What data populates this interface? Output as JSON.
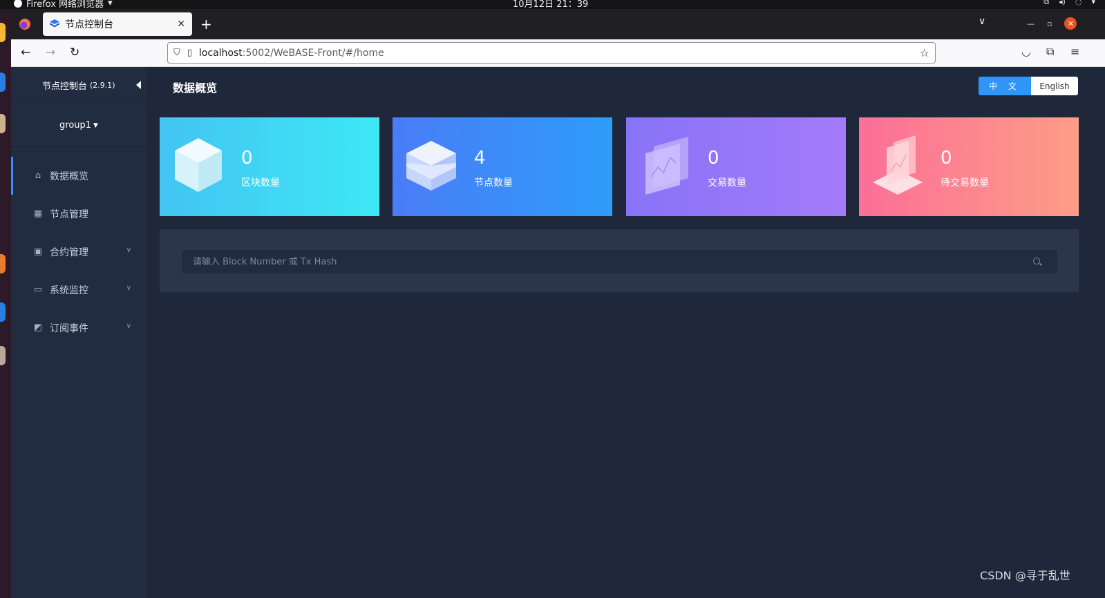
{
  "os": {
    "app_name": "Firefox 网络浏览器",
    "clock": "10月12日 21：39"
  },
  "browser": {
    "tab_title": "节点控制台",
    "url_host": "localhost",
    "url_path": ":5002/WeBASE-Front/#/home"
  },
  "sidebar": {
    "brand": "节点控制台",
    "version": "(2.9.1)",
    "group": "group1",
    "items": [
      {
        "label": "数据概览",
        "icon": "home-icon",
        "active": true,
        "expandable": false
      },
      {
        "label": "节点管理",
        "icon": "calendar-icon",
        "active": false,
        "expandable": false
      },
      {
        "label": "合约管理",
        "icon": "clipboard-icon",
        "active": false,
        "expandable": true
      },
      {
        "label": "系统监控",
        "icon": "monitor-icon",
        "active": false,
        "expandable": true
      },
      {
        "label": "订阅事件",
        "icon": "rss-icon",
        "active": false,
        "expandable": true
      }
    ]
  },
  "main": {
    "title": "数据概览",
    "lang_zh": "中 文",
    "lang_en": "English",
    "cards": [
      {
        "value": "0",
        "label": "区块数量",
        "icon": "cube-icon"
      },
      {
        "value": "4",
        "label": "节点数量",
        "icon": "server-icon"
      },
      {
        "value": "0",
        "label": "交易数量",
        "icon": "transaction-chart-icon"
      },
      {
        "value": "0",
        "label": "待交易数量",
        "icon": "pending-transaction-icon"
      }
    ],
    "search_placeholder": "请输入 Block Number 或 Tx Hash"
  },
  "watermark": "CSDN @寻于乱世",
  "colors": {
    "page_bg": "#1f273a",
    "sidebar_bg": "#212c40",
    "accent": "#2f95f7"
  }
}
